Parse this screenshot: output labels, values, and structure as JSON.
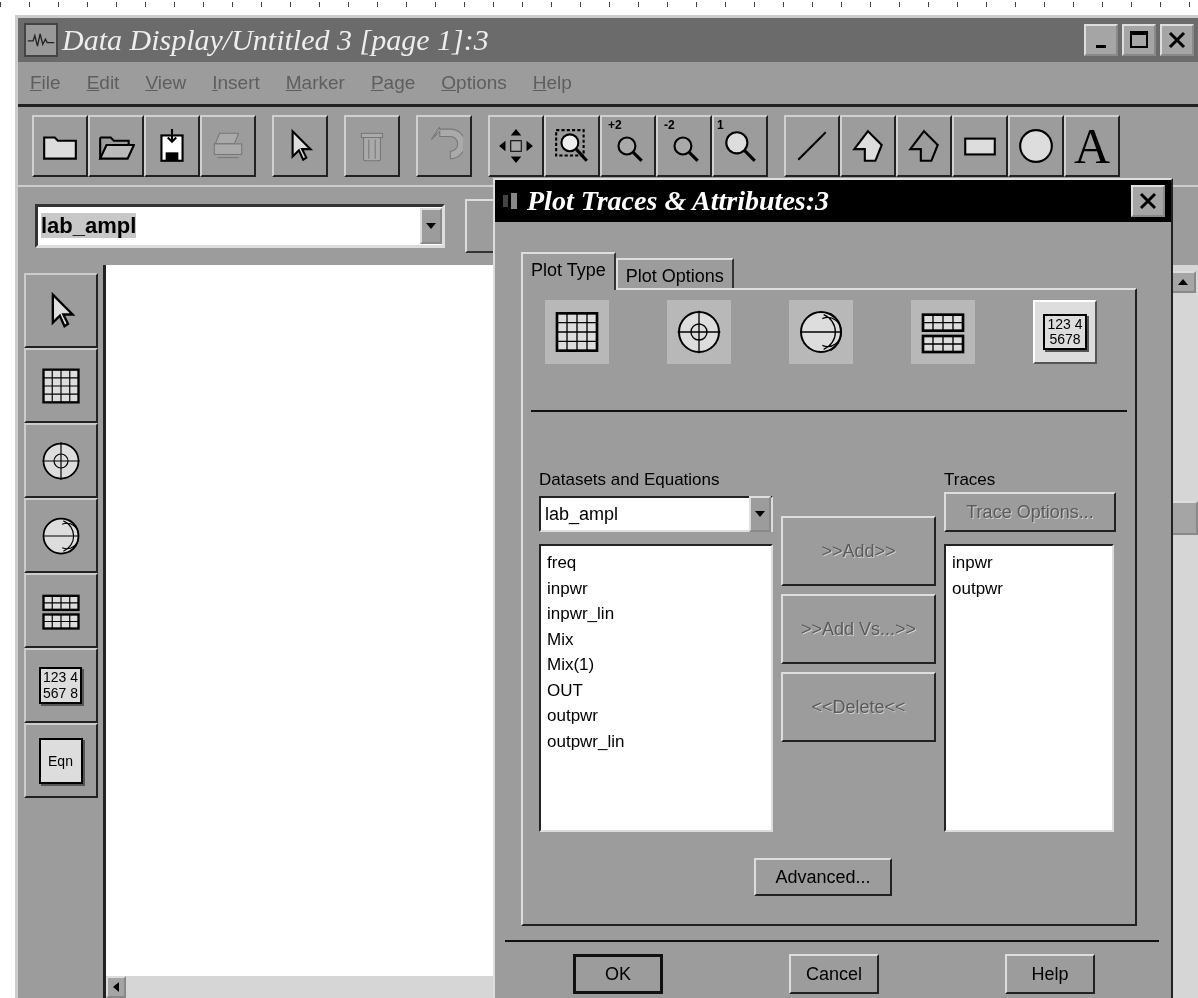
{
  "window": {
    "title": "Data Display/Untitled 3 [page 1]:3",
    "controls": [
      {
        "kind": "minimize"
      },
      {
        "kind": "maximize"
      },
      {
        "kind": "close"
      }
    ]
  },
  "menu": [
    {
      "label": "File"
    },
    {
      "label": "Edit"
    },
    {
      "label": "View"
    },
    {
      "label": "Insert"
    },
    {
      "label": "Marker"
    },
    {
      "label": "Page"
    },
    {
      "label": "Options"
    },
    {
      "label": "Help"
    }
  ],
  "toolbar": [
    {
      "kind": "folder",
      "disabled": false,
      "gap_before": false
    },
    {
      "kind": "open-folder",
      "disabled": false,
      "gap_before": false
    },
    {
      "kind": "floppy",
      "disabled": false,
      "gap_before": false
    },
    {
      "kind": "printer",
      "disabled": true,
      "gap_before": false
    },
    {
      "kind": "pointer",
      "disabled": false,
      "gap_before": true
    },
    {
      "kind": "trash",
      "disabled": true,
      "gap_before": true
    },
    {
      "kind": "undo",
      "disabled": true,
      "gap_before": true
    },
    {
      "kind": "move",
      "disabled": false,
      "gap_before": true
    },
    {
      "kind": "zoom-box",
      "disabled": false,
      "gap_before": false
    },
    {
      "kind": "magnifier",
      "label": "+2",
      "disabled": false,
      "gap_before": false
    },
    {
      "kind": "magnifier",
      "label": "-2",
      "disabled": false,
      "gap_before": false
    },
    {
      "kind": "magnifier-inner",
      "label": "1",
      "disabled": false,
      "gap_before": false
    },
    {
      "kind": "line",
      "disabled": false,
      "gap_before": true
    },
    {
      "kind": "arrow-shape",
      "disabled": false,
      "gap_before": false
    },
    {
      "kind": "arrow-outline",
      "disabled": false,
      "gap_before": false
    },
    {
      "kind": "rectangle",
      "disabled": false,
      "gap_before": false
    },
    {
      "kind": "circle",
      "disabled": false,
      "gap_before": false
    },
    {
      "kind": "text",
      "label": "A",
      "disabled": false,
      "gap_before": false
    }
  ],
  "dataset_combo": {
    "value": "lab_ampl",
    "highlighted": true
  },
  "palette": [
    {
      "kind": "pointer"
    },
    {
      "kind": "grid"
    },
    {
      "kind": "polar"
    },
    {
      "kind": "smith"
    },
    {
      "kind": "stacked-grid"
    },
    {
      "kind": "table",
      "lines": [
        "123 4",
        "567 8"
      ]
    },
    {
      "kind": "equation",
      "label": "Eqn"
    }
  ],
  "dialog": {
    "title": "Plot Traces & Attributes:3",
    "tabs": [
      {
        "label": "Plot Type",
        "selected": true
      },
      {
        "label": "Plot Options",
        "selected": false
      }
    ],
    "plot_types": [
      {
        "kind": "grid",
        "selected": false
      },
      {
        "kind": "polar",
        "selected": false
      },
      {
        "kind": "smith",
        "selected": false
      },
      {
        "kind": "stacked-grid",
        "selected": false
      },
      {
        "kind": "table",
        "lines": [
          "123 4",
          "5678"
        ],
        "selected": true
      }
    ],
    "datasets_label": "Datasets and Equations",
    "dataset_combo": {
      "value": "lab_ampl"
    },
    "datasets": [
      "freq",
      "inpwr",
      "inpwr_lin",
      "Mix",
      "Mix(1)",
      "OUT",
      "outpwr",
      "outpwr_lin"
    ],
    "actions": [
      {
        "label": ">>Add>>",
        "disabled": true
      },
      {
        "label": ">>Add Vs...>>",
        "disabled": true
      },
      {
        "label": "<<Delete<<",
        "disabled": true
      }
    ],
    "traces_label": "Traces",
    "trace_options": {
      "label": "Trace Options...",
      "disabled": true
    },
    "traces": [
      "inpwr",
      "outpwr"
    ],
    "advanced": "Advanced...",
    "buttons": [
      "OK",
      "Cancel",
      "Help"
    ]
  }
}
